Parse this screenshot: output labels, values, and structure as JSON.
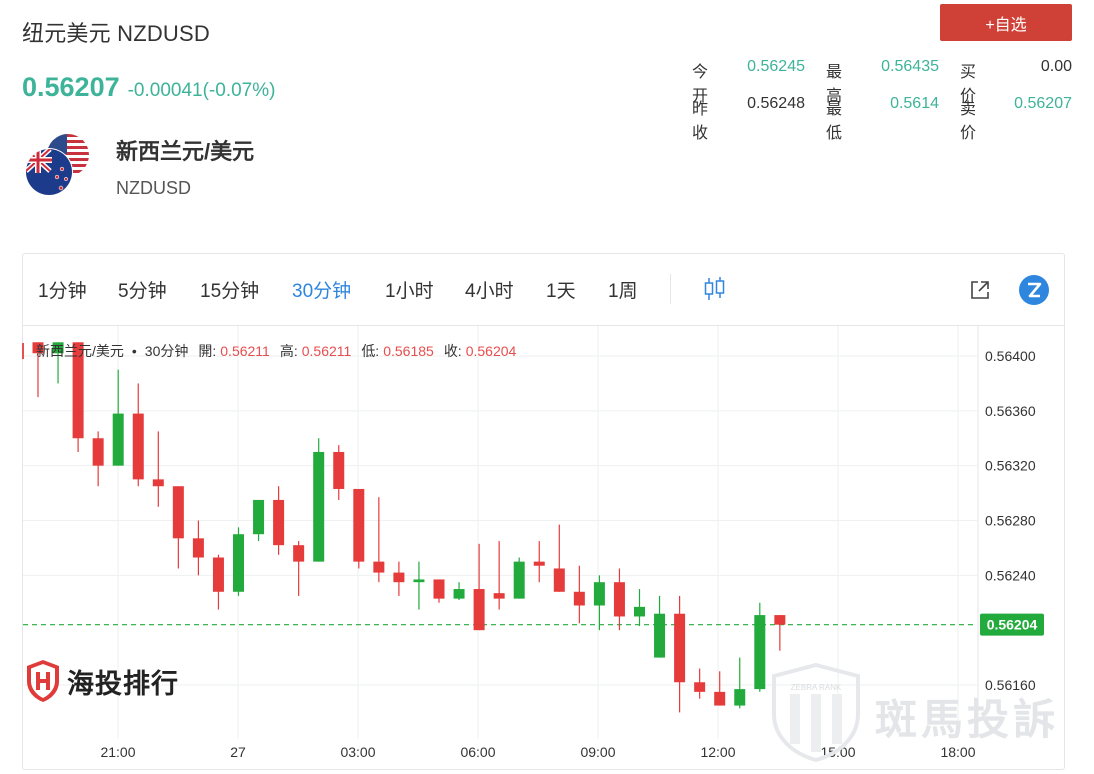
{
  "header": {
    "title": "纽元美元 NZDUSD",
    "last_price": "0.56207",
    "change": "-0.00041(-0.07%)",
    "watch_button": "+自选"
  },
  "stats": {
    "open_label": "今开",
    "open_value": "0.56245",
    "high_label": "最高",
    "high_value": "0.56435",
    "bid_label": "买价",
    "bid_value": "0.00",
    "prev_close_label": "昨收",
    "prev_close_value": "0.56248",
    "low_label": "最低",
    "low_value": "0.5614",
    "ask_label": "卖价",
    "ask_value": "0.56207"
  },
  "instrument": {
    "name": "新西兰元/美元",
    "code": "NZDUSD",
    "flag_icon": "nz-us-flag-icon"
  },
  "toolbar": {
    "intervals": [
      "1分钟",
      "5分钟",
      "15分钟",
      "30分钟",
      "1小时",
      "4小时",
      "1天",
      "1周"
    ],
    "active_interval": "30分钟",
    "icons": [
      "candle-style-icon",
      "external-link-icon",
      "z-brand-icon"
    ]
  },
  "legend": {
    "symbol": "新西兰元/美元",
    "separator": "•",
    "interval": "30分钟",
    "open_label": "開:",
    "open_value": "0.56211",
    "high_label": "高:",
    "high_value": "0.56211",
    "low_label": "低:",
    "low_value": "0.56185",
    "close_label": "收:",
    "close_value": "0.56204"
  },
  "watermarks": {
    "brand_text": "海投排行",
    "zebra_text": "斑馬投訴",
    "zebra_badge": "ZEBRA RANK"
  },
  "colors": {
    "up": "#22ab3c",
    "down": "#e63b3b",
    "accent": "#3db39a",
    "button": "#cf4036",
    "active_tab": "#2e86de",
    "price_tag": "#22ab3c"
  },
  "chart_data": {
    "type": "candlestick",
    "interval": "30分钟",
    "y_ticks": [
      "0.56400",
      "0.56360",
      "0.56320",
      "0.56280",
      "0.56240",
      "0.56160"
    ],
    "y_tick_values": [
      0.564,
      0.5636,
      0.5632,
      0.5628,
      0.5624,
      0.5616
    ],
    "x_ticks": [
      "21:00",
      "27",
      "03:00",
      "06:00",
      "09:00",
      "12:00",
      "15:00",
      "18:00"
    ],
    "current_price_label": "0.56204",
    "current_price": 0.56204,
    "candles": [
      {
        "o": 0.5641,
        "h": 0.5641,
        "l": 0.5637,
        "c": 0.56402
      },
      {
        "o": 0.56402,
        "h": 0.5641,
        "l": 0.5638,
        "c": 0.5641
      },
      {
        "o": 0.5641,
        "h": 0.5641,
        "l": 0.5633,
        "c": 0.5634
      },
      {
        "o": 0.5634,
        "h": 0.56345,
        "l": 0.56305,
        "c": 0.5632
      },
      {
        "o": 0.5632,
        "h": 0.5639,
        "l": 0.5632,
        "c": 0.56358
      },
      {
        "o": 0.56358,
        "h": 0.5638,
        "l": 0.56305,
        "c": 0.5631
      },
      {
        "o": 0.5631,
        "h": 0.56345,
        "l": 0.5629,
        "c": 0.56305
      },
      {
        "o": 0.56305,
        "h": 0.56305,
        "l": 0.56245,
        "c": 0.56267
      },
      {
        "o": 0.56267,
        "h": 0.5628,
        "l": 0.5624,
        "c": 0.56253
      },
      {
        "o": 0.56253,
        "h": 0.56255,
        "l": 0.56215,
        "c": 0.56228
      },
      {
        "o": 0.56228,
        "h": 0.56275,
        "l": 0.56225,
        "c": 0.5627
      },
      {
        "o": 0.5627,
        "h": 0.56295,
        "l": 0.56265,
        "c": 0.56295
      },
      {
        "o": 0.56295,
        "h": 0.56305,
        "l": 0.56255,
        "c": 0.56262
      },
      {
        "o": 0.56262,
        "h": 0.56265,
        "l": 0.56225,
        "c": 0.5625
      },
      {
        "o": 0.5625,
        "h": 0.5634,
        "l": 0.5625,
        "c": 0.5633
      },
      {
        "o": 0.5633,
        "h": 0.56335,
        "l": 0.56295,
        "c": 0.56303
      },
      {
        "o": 0.56303,
        "h": 0.56303,
        "l": 0.56245,
        "c": 0.5625
      },
      {
        "o": 0.5625,
        "h": 0.56297,
        "l": 0.56235,
        "c": 0.56242
      },
      {
        "o": 0.56242,
        "h": 0.5625,
        "l": 0.56225,
        "c": 0.56235
      },
      {
        "o": 0.56235,
        "h": 0.5625,
        "l": 0.56215,
        "c": 0.56237
      },
      {
        "o": 0.56237,
        "h": 0.56237,
        "l": 0.5622,
        "c": 0.56223
      },
      {
        "o": 0.56223,
        "h": 0.56235,
        "l": 0.56222,
        "c": 0.5623
      },
      {
        "o": 0.5623,
        "h": 0.56263,
        "l": 0.562,
        "c": 0.562
      },
      {
        "o": 0.56227,
        "h": 0.56265,
        "l": 0.56215,
        "c": 0.56223
      },
      {
        "o": 0.56223,
        "h": 0.56253,
        "l": 0.56223,
        "c": 0.5625
      },
      {
        "o": 0.5625,
        "h": 0.56265,
        "l": 0.56235,
        "c": 0.56247
      },
      {
        "o": 0.56245,
        "h": 0.56277,
        "l": 0.56228,
        "c": 0.56228
      },
      {
        "o": 0.56228,
        "h": 0.56247,
        "l": 0.56205,
        "c": 0.56218
      },
      {
        "o": 0.56218,
        "h": 0.5624,
        "l": 0.562,
        "c": 0.56235
      },
      {
        "o": 0.56235,
        "h": 0.56245,
        "l": 0.562,
        "c": 0.5621
      },
      {
        "o": 0.5621,
        "h": 0.5623,
        "l": 0.56203,
        "c": 0.56217
      },
      {
        "o": 0.5618,
        "h": 0.56225,
        "l": 0.5618,
        "c": 0.56212
      },
      {
        "o": 0.56212,
        "h": 0.56225,
        "l": 0.5614,
        "c": 0.56162
      },
      {
        "o": 0.56162,
        "h": 0.56172,
        "l": 0.5615,
        "c": 0.56155
      },
      {
        "o": 0.56155,
        "h": 0.5617,
        "l": 0.56145,
        "c": 0.56145
      },
      {
        "o": 0.56145,
        "h": 0.5618,
        "l": 0.56143,
        "c": 0.56157
      },
      {
        "o": 0.56157,
        "h": 0.5622,
        "l": 0.56155,
        "c": 0.56211
      },
      {
        "o": 0.56211,
        "h": 0.56211,
        "l": 0.56185,
        "c": 0.56204
      }
    ]
  }
}
